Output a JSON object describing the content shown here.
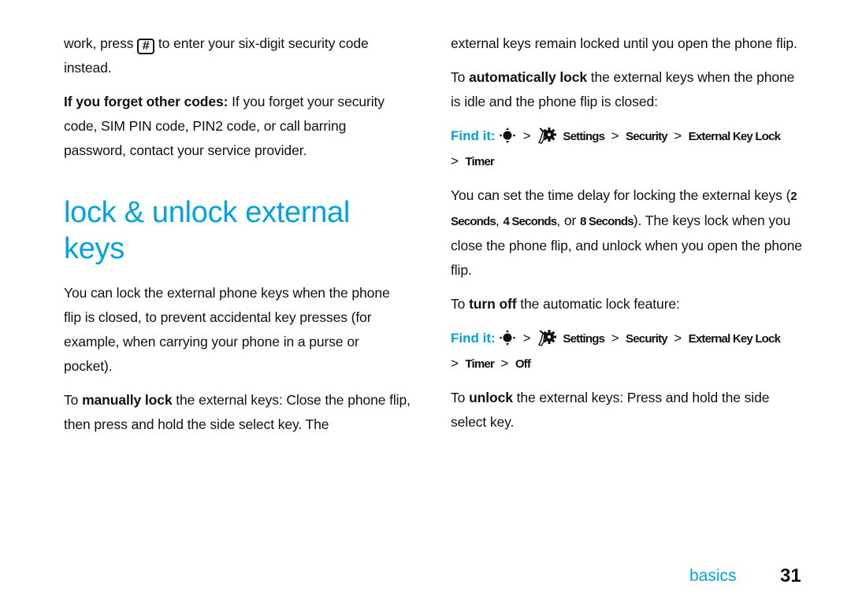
{
  "left_column": {
    "intro": {
      "before_key": "work, press",
      "key_label": "#",
      "after_key": "to enter your six-digit security code instead."
    },
    "forget_codes": {
      "bold": "If you forget other codes:",
      "text": "If you forget your security code, SIM PIN code, PIN2 code, or call barring password, contact your service provider."
    },
    "heading": "lock & unlock external keys",
    "description": "You can lock the external phone keys when the phone flip is closed, to prevent accidental key presses (for example, when carrying your phone in a purse or pocket).",
    "manual_lock": {
      "prefix": "To",
      "bold": "manually lock",
      "text": "the external keys: Close the phone flip, then press and hold the side select key. The"
    }
  },
  "right_column": {
    "continued": "external keys remain locked until you open the phone flip.",
    "auto_lock": {
      "prefix": "To",
      "bold": "automatically lock",
      "text": "the external keys when the phone is idle and the phone flip is closed:"
    },
    "find_it_1": {
      "label": "Find it:",
      "nav_icon": "navigation-key-icon",
      "settings_icon": "settings-icon",
      "path": [
        "Settings",
        "Security",
        "External Key Lock",
        "Timer"
      ]
    },
    "timer_desc": {
      "before": "You can set the time delay for locking the external keys (",
      "options": [
        "2 Seconds",
        "4 Seconds",
        "8 Seconds"
      ],
      "sep1": ", ",
      "sep2": ", or ",
      "after": "). The keys lock when you close the phone flip, and unlock when you open the phone flip."
    },
    "turn_off": {
      "prefix": "To",
      "bold": "turn off",
      "text": "the automatic lock feature:"
    },
    "find_it_2": {
      "label": "Find it:",
      "nav_icon": "navigation-key-icon",
      "settings_icon": "settings-icon",
      "path": [
        "Settings",
        "Security",
        "External Key Lock",
        "Timer",
        "Off"
      ]
    },
    "unlock": {
      "prefix": "To",
      "bold": "unlock",
      "text": "the external keys: Press and hold the side select key."
    }
  },
  "footer": {
    "section": "basics",
    "page_number": "31"
  },
  "colors": {
    "accent": "#00a3e0",
    "text": "#111111"
  }
}
